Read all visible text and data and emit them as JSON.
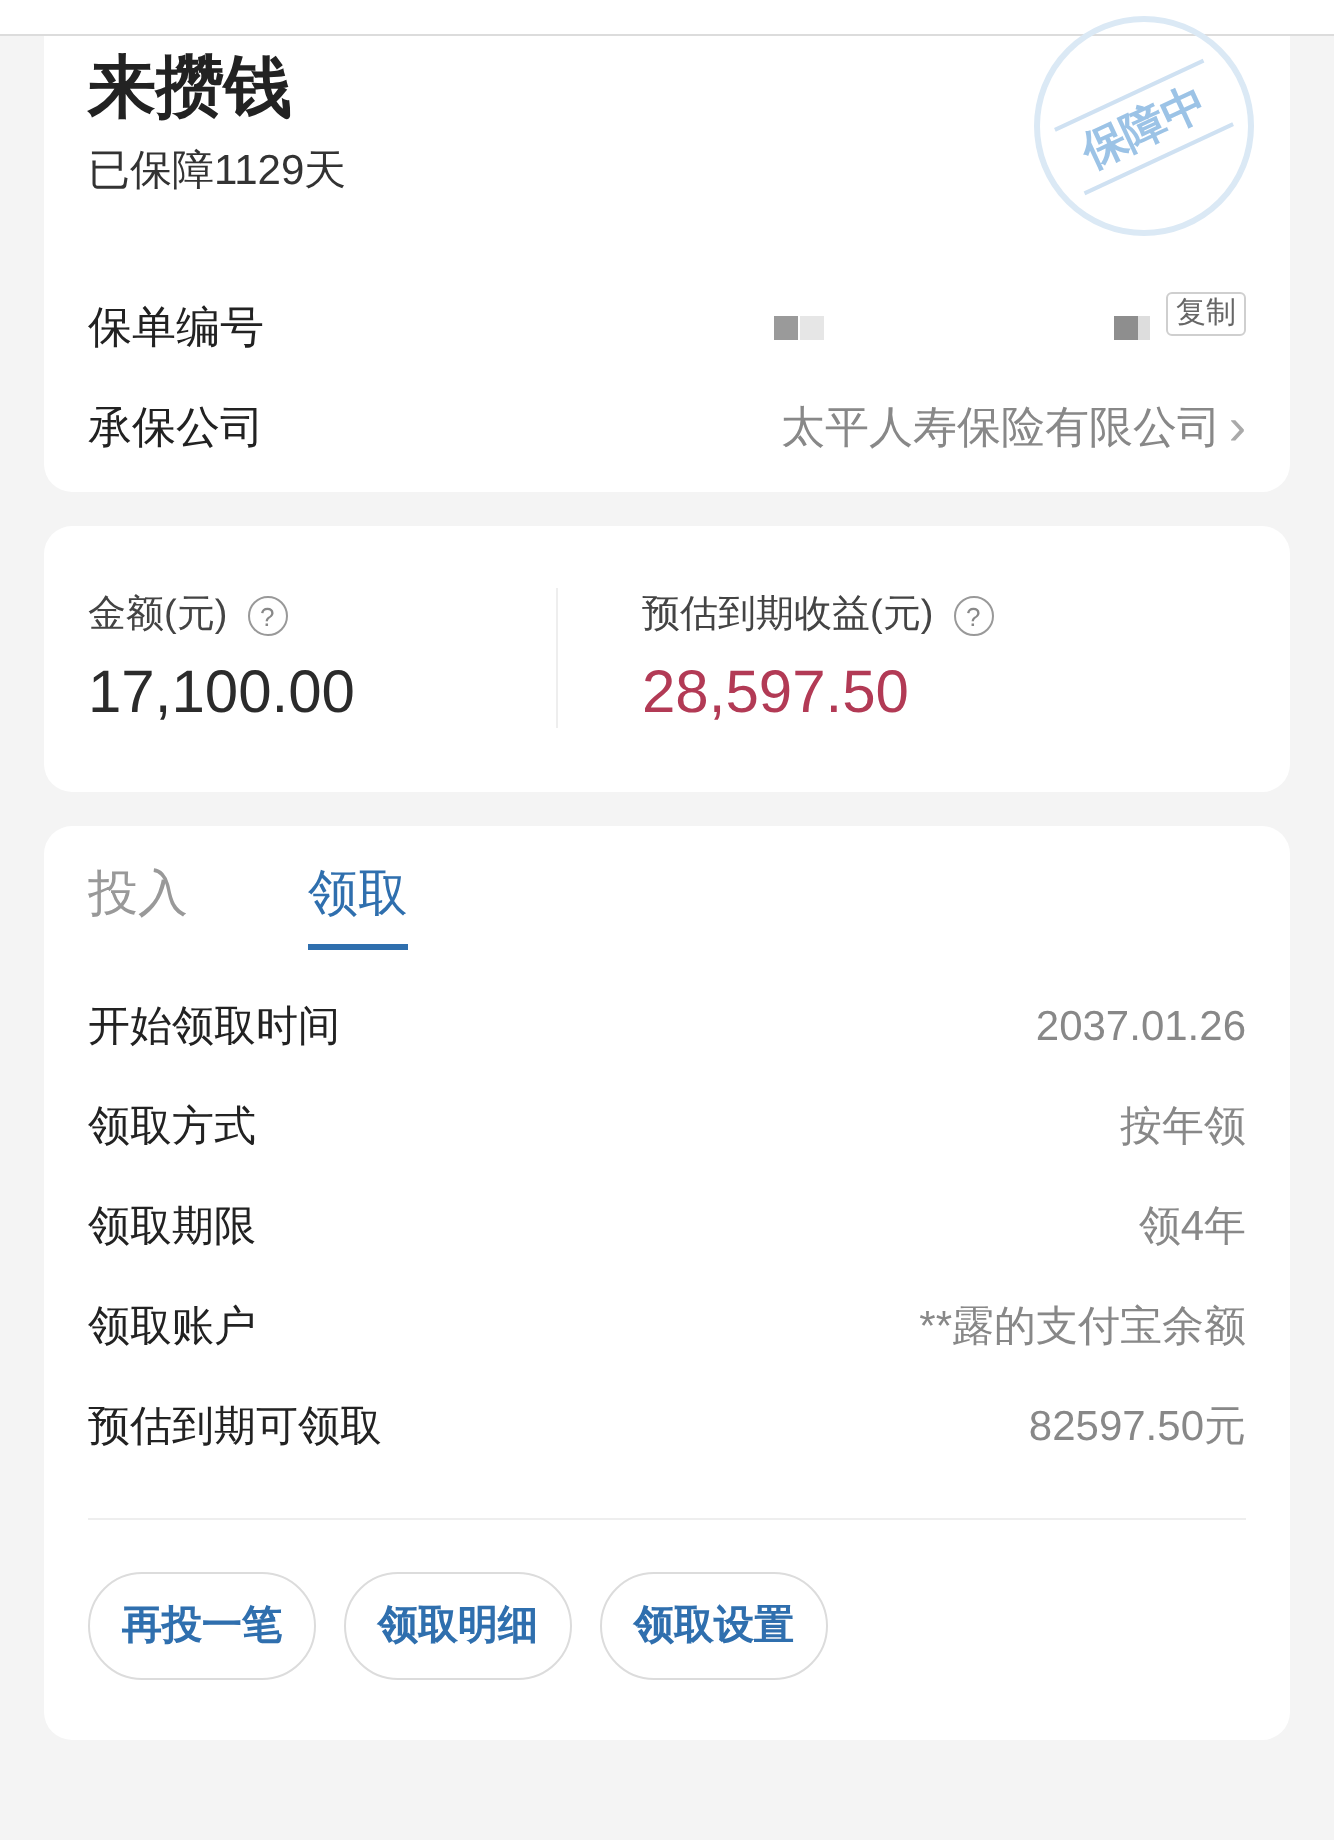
{
  "policy": {
    "name": "来攒钱",
    "days": "已保障1129天",
    "stamp": "保障中",
    "rows": [
      {
        "kind": "number",
        "label": "保单编号",
        "action": "复制"
      },
      {
        "kind": "link",
        "label": "承保公司",
        "value": "太平人寿保险有限公司",
        "chevron": "›"
      }
    ]
  },
  "amounts": [
    {
      "label": "金额(元)",
      "help": "?",
      "value": "17,100.00",
      "color": "#2b2b2b"
    },
    {
      "label": "预估到期收益(元)",
      "help": "?",
      "value": "28,597.50",
      "color": "#b23a55"
    }
  ],
  "tabs": [
    {
      "label": "投入",
      "selected": false
    },
    {
      "label": "领取",
      "selected": true
    }
  ],
  "details": [
    {
      "label": "开始领取时间",
      "value": "2037.01.26"
    },
    {
      "label": "领取方式",
      "value": "按年领"
    },
    {
      "label": "领取期限",
      "value": "领4年"
    },
    {
      "label": "领取账户",
      "value": "**露的支付宝余额"
    },
    {
      "label": "预估到期可领取",
      "value": "82597.50元"
    }
  ],
  "buttons": [
    "再投一笔",
    "领取明细",
    "领取设置"
  ]
}
